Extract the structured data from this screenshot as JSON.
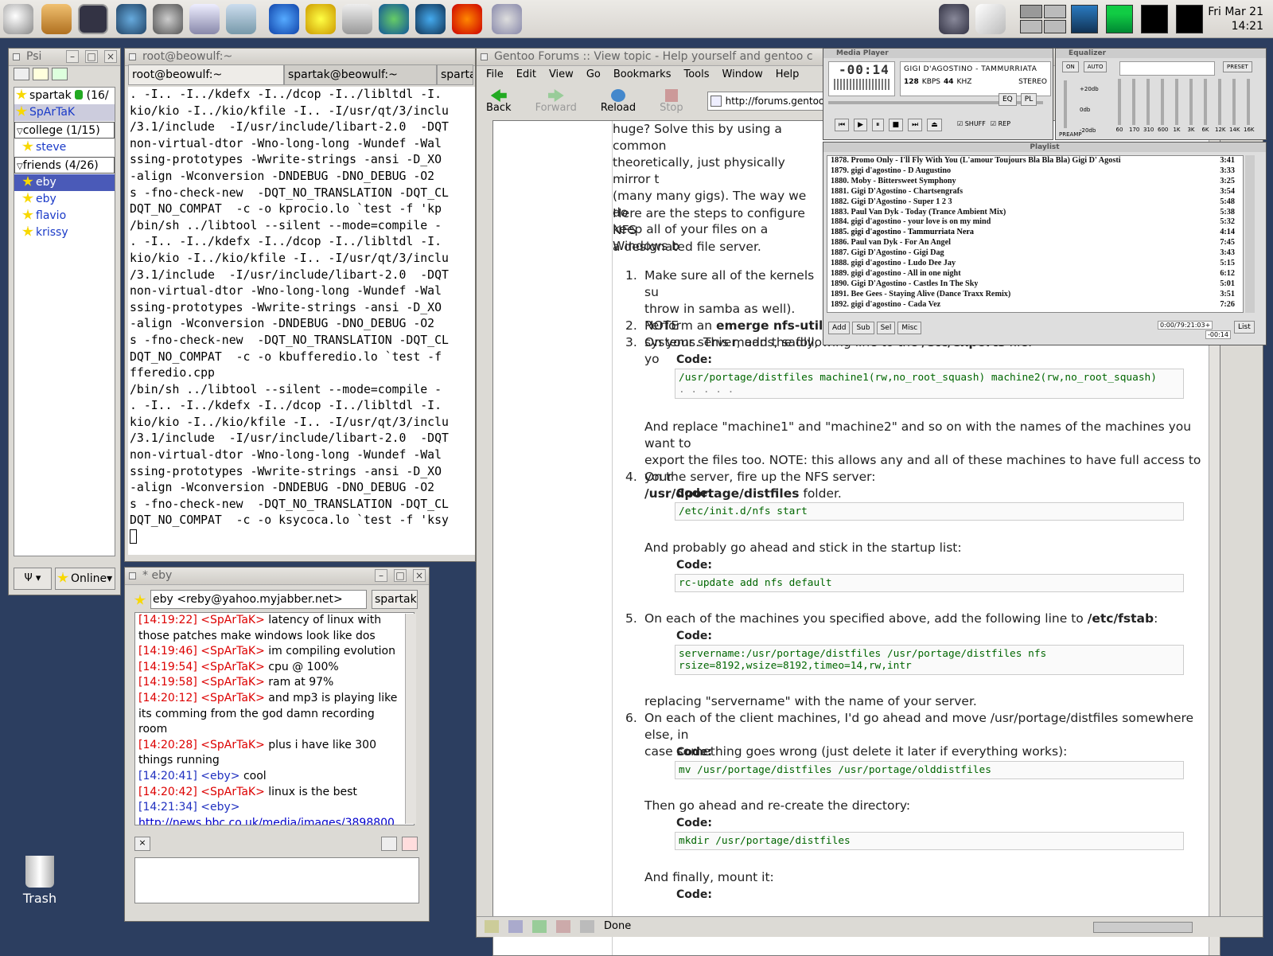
{
  "panel": {
    "clock_day": "Fri Mar 21",
    "clock_time": "14:21"
  },
  "psi": {
    "title": "Psi",
    "account": "spartak",
    "account_count": "(16/",
    "contacts_top": [
      {
        "name": "SpArTaK",
        "color": "#1a3ac8"
      }
    ],
    "college": {
      "label": "college (1/15)",
      "items": [
        "steve"
      ]
    },
    "friends": {
      "label": "friends (4/26)",
      "items": [
        "eby",
        "eby",
        "flavio",
        "krissy"
      ]
    },
    "status": "Online"
  },
  "terminal": {
    "title": "root@beowulf:~",
    "tabs": [
      "root@beowulf:~",
      "spartak@beowulf:~",
      "sparta"
    ],
    "lines": [
      ". -I.. -I../kdefx -I../dcop -I../libltdl -I.",
      "kio/kio -I../kio/kfile -I.. -I/usr/qt/3/inclu",
      "/3.1/include  -I/usr/include/libart-2.0  -DQT",
      "non-virtual-dtor -Wno-long-long -Wundef -Wal",
      "ssing-prototypes -Wwrite-strings -ansi -D_XO",
      "-align -Wconversion -DNDEBUG -DNO_DEBUG -O2",
      "s -fno-check-new  -DQT_NO_TRANSLATION -DQT_CL",
      "DQT_NO_COMPAT  -c -o kprocio.lo `test -f 'kp",
      "/bin/sh ../libtool --silent --mode=compile -",
      ". -I.. -I../kdefx -I../dcop -I../libltdl -I.",
      "kio/kio -I../kio/kfile -I.. -I/usr/qt/3/inclu",
      "/3.1/include  -I/usr/include/libart-2.0  -DQT",
      "non-virtual-dtor -Wno-long-long -Wundef -Wal",
      "ssing-prototypes -Wwrite-strings -ansi -D_XO",
      "-align -Wconversion -DNDEBUG -DNO_DEBUG -O2",
      "s -fno-check-new  -DQT_NO_TRANSLATION -DQT_CL",
      "DQT_NO_COMPAT  -c -o kbufferedio.lo `test -f",
      "fferedio.cpp",
      "/bin/sh ../libtool --silent --mode=compile -",
      ". -I.. -I../kdefx -I../dcop -I../libltdl -I.",
      "kio/kio -I../kio/kfile -I.. -I/usr/qt/3/inclu",
      "/3.1/include  -I/usr/include/libart-2.0  -DQT",
      "non-virtual-dtor -Wno-long-long -Wundef -Wal",
      "ssing-prototypes -Wwrite-strings -ansi -D_XO",
      "-align -Wconversion -DNDEBUG -DNO_DEBUG -O2",
      "s -fno-check-new  -DQT_NO_TRANSLATION -DQT_CL",
      "DQT_NO_COMPAT  -c -o ksycoca.lo `test -f 'ksy"
    ]
  },
  "chat": {
    "title": "* eby",
    "to": "eby <reby@yahoo.myjabber.net>",
    "from": "spartak",
    "messages": [
      {
        "time": "[14:19:22]",
        "nick": "<SpArTaK>",
        "text": "latency of linux with those patches make windows look like dos",
        "self": true
      },
      {
        "time": "[14:19:46]",
        "nick": "<SpArTaK>",
        "text": "im compiling evolution",
        "self": true
      },
      {
        "time": "[14:19:54]",
        "nick": "<SpArTaK>",
        "text": "cpu @ 100%",
        "self": true
      },
      {
        "time": "[14:19:58]",
        "nick": "<SpArTaK>",
        "text": "ram at 97%",
        "self": true
      },
      {
        "time": "[14:20:12]",
        "nick": "<SpArTaK>",
        "text": "and mp3 is playing like its comming from the god damn recording room",
        "self": true
      },
      {
        "time": "[14:20:28]",
        "nick": "<SpArTaK>",
        "text": "plus i have like 300 things running",
        "self": true
      },
      {
        "time": "[14:20:41]",
        "nick": "<eby>",
        "text": "cool",
        "self": false
      },
      {
        "time": "[14:20:42]",
        "nick": "<SpArTaK>",
        "text": "linux is the best",
        "self": true
      },
      {
        "time": "[14:21:34]",
        "nick": "<eby>",
        "text": "",
        "self": false
      }
    ],
    "link": "http://news.bbc.co.uk/media/images/3898800"
  },
  "browser": {
    "title": "Gentoo Forums :: View topic - Help yourself and gentoo c",
    "menu": [
      "File",
      "Edit",
      "View",
      "Go",
      "Bookmarks",
      "Tools",
      "Window",
      "Help"
    ],
    "toolbar": {
      "back": "Back",
      "forward": "Forward",
      "reload": "Reload",
      "stop": "Stop"
    },
    "url": "http://forums.gentoo.org/viewto",
    "status": "Done",
    "intro1": [
      "huge? Solve this by using a common",
      "theoretically, just physically mirror t",
      "(many many gigs). The way we do",
      "keep all of your files on a Windows b"
    ],
    "intro2": [
      "Here are the steps to configure NFS",
      "a designated file server."
    ],
    "step1": [
      "Make sure all of the kernels su",
      "throw in samba as well). NOTE",
      "systems. This means, sadly, yo"
    ],
    "step2_pre": "Perform an ",
    "step2_bold": "emerge nfs-utils",
    "step3_pre": "On your server, add the following line to the ",
    "step3_bold": "/etc/exports",
    "step3_post": " file:",
    "code_label": "Code:",
    "code1": "/usr/portage/distfiles machine1(rw,no_root_squash) machine2(rw,no_root_squash)",
    "code1b": ". . . . .",
    "para3": [
      "And replace \"machine1\" and \"machine2\" and so on with the names of the machines you want to",
      "export the files too. NOTE: this allows any and all of these machines to have full access to your"
    ],
    "para3_bold": "/usr/dportage/distfiles",
    "para3_post": " folder.",
    "step4": "On the server, fire up the NFS server:",
    "code2": "/etc/init.d/nfs start",
    "para4": "And probably go ahead and stick in the startup list:",
    "code3": "rc-update add nfs default",
    "step5_pre": "On each of the machines you specified above, add the following line to ",
    "step5_bold": "/etc/fstab",
    "step5_post": ":",
    "code4a": "servername:/usr/portage/distfiles  /usr/portage/distfiles  nfs",
    "code4b": " rsize=8192,wsize=8192,timeo=14,rw,intr",
    "para5": "replacing \"servername\" with the name of your server.",
    "step6": [
      "On each of the client machines, I'd go ahead and move /usr/portage/distfiles somewhere else, in",
      "case something goes wrong (just delete it later if everything works):"
    ],
    "code5": "mv /usr/portage/distfiles /usr/portage/olddistfiles",
    "para6": "Then go ahead and re-create the directory:",
    "code6": "mkdir /usr/portage/distfiles",
    "para7": "And finally, mount it:",
    "nums": [
      "1.",
      "2.",
      "3.",
      "4.",
      "5.",
      "6."
    ]
  },
  "xmms": {
    "player_title": "Media Player",
    "time": "-00:14",
    "song": "GIGI D'AGOSTINO - TAMMURRIATA",
    "kbps": "128",
    "kbps_unit": "KBPS",
    "khz": "44",
    "khz_unit": "KHZ",
    "stereo": "STEREO",
    "eq_btn": "EQ",
    "pl_btn": "PL",
    "shuff": "SHUFF",
    "rep": "REP",
    "eq_title": "Equalizer",
    "eq_on": "ON",
    "eq_auto": "AUTO",
    "eq_preset": "PRESET",
    "db_top": "+20db",
    "db_mid": "0db",
    "db_bot": "-20db",
    "preamp": "PREAMP",
    "bands": [
      "60",
      "170",
      "310",
      "600",
      "1K",
      "3K",
      "6K",
      "12K",
      "14K",
      "16K"
    ],
    "pl_title": "Playlist",
    "playlist": [
      {
        "t": "1878. Promo Only - I'll Fly With You (L'amour Toujours Bla Bla Bla) Gigi D' Agosti",
        "d": "3:41"
      },
      {
        "t": "1879. gigi d'agostino - D Augustino",
        "d": "3:33"
      },
      {
        "t": "1880. Moby - Bittersweet Symphony",
        "d": "3:25"
      },
      {
        "t": "1881. Gigi D'Agostino - Chartsengrafs",
        "d": "3:54"
      },
      {
        "t": "1882. Gigi D'Agostino - Super 1 2 3",
        "d": "5:48"
      },
      {
        "t": "1883. Paul Van Dyk - Today (Trance Ambient Mix)",
        "d": "5:38"
      },
      {
        "t": "1884. gigi d'agostino - your love is on my mind",
        "d": "5:32"
      },
      {
        "t": "1885. gigi d'agostino - Tammurriata Nera",
        "d": "4:14"
      },
      {
        "t": "1886. Paul van Dyk - For An Angel",
        "d": "7:45"
      },
      {
        "t": "1887. Gigi D'Agostino - Gigi Dag",
        "d": "3:43"
      },
      {
        "t": "1888. gigi d'agostino - Ludo Dee Jay",
        "d": "5:15"
      },
      {
        "t": "1889. gigi d'agostino - All in one night",
        "d": "6:12"
      },
      {
        "t": "1890. Gigi D'Agostino - Castles In The Sky",
        "d": "5:01"
      },
      {
        "t": "1891. Bee Gees - Staying Alive (Dance Traxx Remix)",
        "d": "3:51"
      },
      {
        "t": "1892. gigi d'agostino - Cada Vez",
        "d": "7:26"
      }
    ],
    "pl_buttons": [
      "Add",
      "Sub",
      "Sel",
      "Misc"
    ],
    "pl_time": "0:00/79:21:03+",
    "pl_rem": "-00:14",
    "pl_list": "List"
  },
  "desktop": {
    "trash": "Trash"
  },
  "colors": {
    "desktop": "#2c3e60",
    "selection": "#4a5ab8",
    "self_nick": "#dd0000",
    "other_nick": "#2030c0"
  }
}
